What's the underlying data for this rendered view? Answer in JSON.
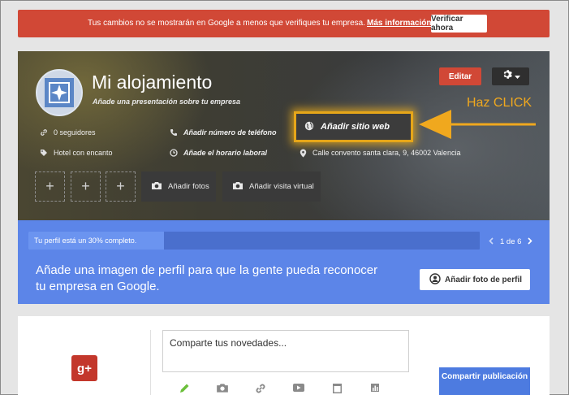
{
  "banner": {
    "message": "Tus cambios no se mostrarán en Google a menos que verifiques tu empresa.",
    "link": "Más información",
    "button": "Verificar ahora",
    "color": "#d14836"
  },
  "profile": {
    "name": "Mi alojamiento",
    "tagline": "Añade una presentación sobre tu empresa",
    "edit_button": "Editar",
    "followers": "0 seguidores",
    "category": "Hotel con encanto",
    "phone_action": "Añadir número de teléfono",
    "hours_action": "Añade el horario laboral",
    "website_action": "Añadir sitio web",
    "address": "Calle convento santa clara, 9, 46002 Valencia",
    "add_photos": "Añadir fotos",
    "add_tour": "Añadir visita virtual",
    "placeholder_symbol": "+",
    "highlight_color": "#e6a619"
  },
  "annotation": {
    "text": "Haz CLICK",
    "color": "#f0a81e"
  },
  "completion": {
    "progress_text": "Tu perfil está un 30% completo.",
    "progress_percent": 30,
    "pager": "1 de 6",
    "message": "Añade una imagen de perfil para que la gente pueda reconocer tu empresa en Google.",
    "button": "Añadir foto de perfil",
    "panel_color": "#5c85e8"
  },
  "share": {
    "placeholder": "Comparte tus novedades...",
    "button": "Compartir publicación",
    "logo_text": "g+",
    "tool_icons": [
      "pencil-icon",
      "camera-icon",
      "link-icon",
      "video-icon",
      "event-icon",
      "chart-icon"
    ]
  }
}
